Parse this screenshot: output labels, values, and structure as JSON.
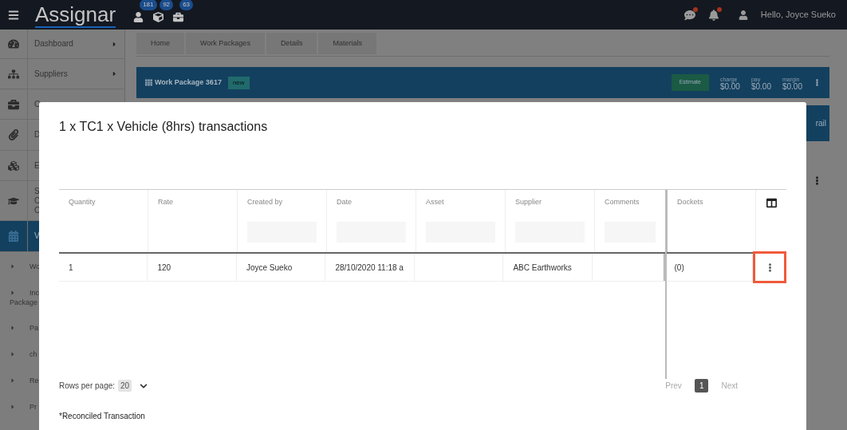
{
  "topbar": {
    "logo": "Assignar",
    "badges": [
      {
        "count": "181"
      },
      {
        "count": "92"
      },
      {
        "count": "63"
      }
    ],
    "notifications": [
      {
        "unread": true
      },
      {
        "unread": true
      }
    ],
    "user": "Hello, Joyce Sueko"
  },
  "sidebar": {
    "items": [
      {
        "label": "Dashboard",
        "selected": false,
        "expandable": true
      },
      {
        "label": "Suppliers",
        "selected": false,
        "expandable": true
      },
      {
        "label": "C",
        "selected": false
      },
      {
        "label": "D",
        "selected": false
      },
      {
        "label": "E",
        "selected": false
      },
      {
        "label": "S C C",
        "selected": false
      },
      {
        "label": "V",
        "selected": true
      }
    ],
    "subitems": [
      {
        "label": "Wo"
      },
      {
        "label": "Inc Package"
      },
      {
        "label": "Pa"
      },
      {
        "label": "ch"
      },
      {
        "label": "Re"
      },
      {
        "label": "Pr"
      }
    ]
  },
  "breadcrumbs": [
    "Home",
    "Work Packages",
    "Details",
    "Materials"
  ],
  "package_header": {
    "title": "Work Package 3617",
    "status": "new",
    "estimate_button": "Estimate",
    "stats": [
      {
        "label": "charge",
        "value": "$0.00"
      },
      {
        "label": "pay",
        "value": "$0.00"
      },
      {
        "label": "margin",
        "value": "$0.00"
      }
    ]
  },
  "side_button": "rail",
  "modal": {
    "title": "1 x TC1 x Vehicle (8hrs) transactions",
    "table": {
      "columns": [
        {
          "label": "Quantity",
          "kind": "plain"
        },
        {
          "label": "Rate",
          "kind": "plain"
        },
        {
          "label": "Created by",
          "kind": "filterable"
        },
        {
          "label": "Date",
          "kind": "filterable"
        },
        {
          "label": "Asset",
          "kind": "filterable"
        },
        {
          "label": "Supplier",
          "kind": "filterable"
        },
        {
          "label": "Comments",
          "kind": "filterable"
        },
        {
          "label": "Dockets",
          "kind": "plain"
        }
      ],
      "rows": [
        {
          "cells": [
            "1",
            "120",
            "Joyce Sueko",
            "28/10/2020 11:18 a",
            "",
            "ABC Earthworks",
            "",
            "(0)"
          ],
          "actions_highlighted": true
        }
      ]
    },
    "pagination": {
      "rows_per_page_label": "Rows per page:",
      "rows_per_page": "20",
      "prev": "Prev",
      "pages": [
        {
          "label": "1",
          "selected": true
        }
      ],
      "next": "Next"
    },
    "footnote": "*Reconciled Transaction"
  }
}
